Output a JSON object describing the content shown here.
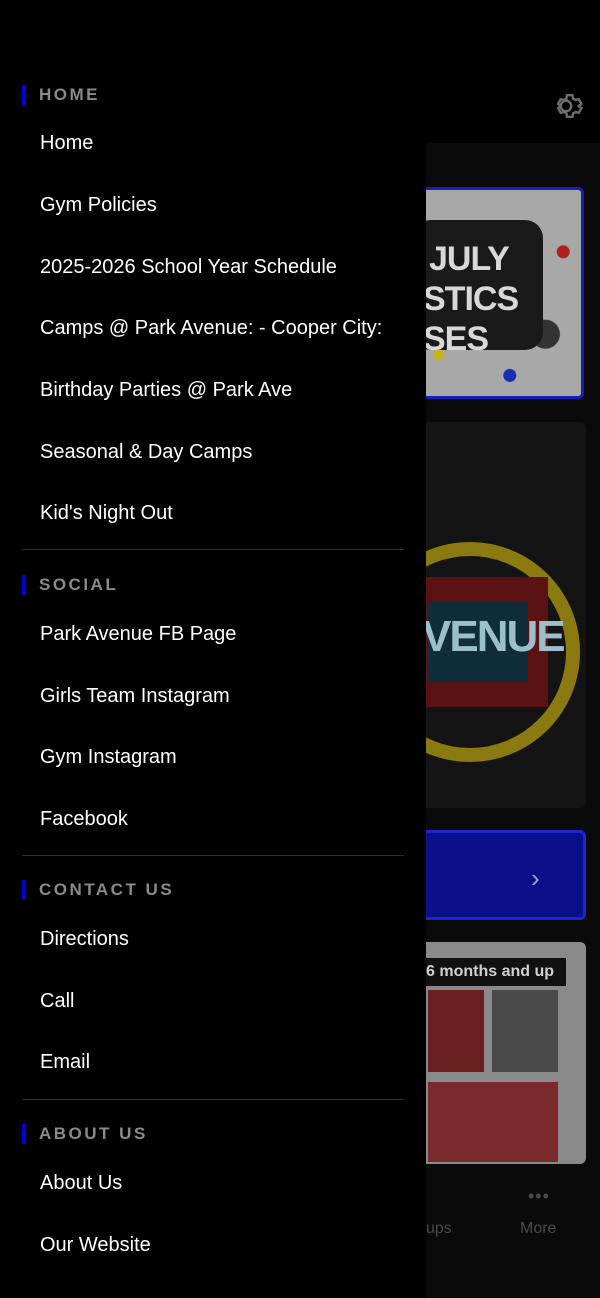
{
  "background": {
    "card1_lines": [
      "JULY",
      "STICS",
      "SES"
    ],
    "card2_text": "VENUE",
    "card4_banner": "6 months and up",
    "bottom_tabs": [
      {
        "label": "ups"
      },
      {
        "label": "More"
      }
    ]
  },
  "drawer": {
    "sections": [
      {
        "title": "HOME",
        "items": [
          "Home",
          "Gym Policies",
          "2025-2026 School Year Schedule",
          "Camps @ Park Avenue: - Cooper City:",
          "Birthday Parties @ Park Ave",
          "Seasonal & Day Camps",
          "Kid's Night Out"
        ]
      },
      {
        "title": "SOCIAL",
        "items": [
          "Park Avenue FB Page",
          "Girls Team Instagram",
          "Gym Instagram",
          "Facebook"
        ]
      },
      {
        "title": "CONTACT US",
        "items": [
          "Directions",
          "Call",
          "Email"
        ]
      },
      {
        "title": "ABOUT US",
        "items": [
          "About Us",
          "Our Website"
        ]
      }
    ]
  },
  "colors": {
    "accent": "#0000e0",
    "drawer_bg": "#000000",
    "section_title": "#8a8a8a",
    "item_text": "#ffffff"
  },
  "icons": {
    "settings": "gear-icon",
    "next": "chevron-right-icon",
    "more": "more-dots-icon"
  }
}
